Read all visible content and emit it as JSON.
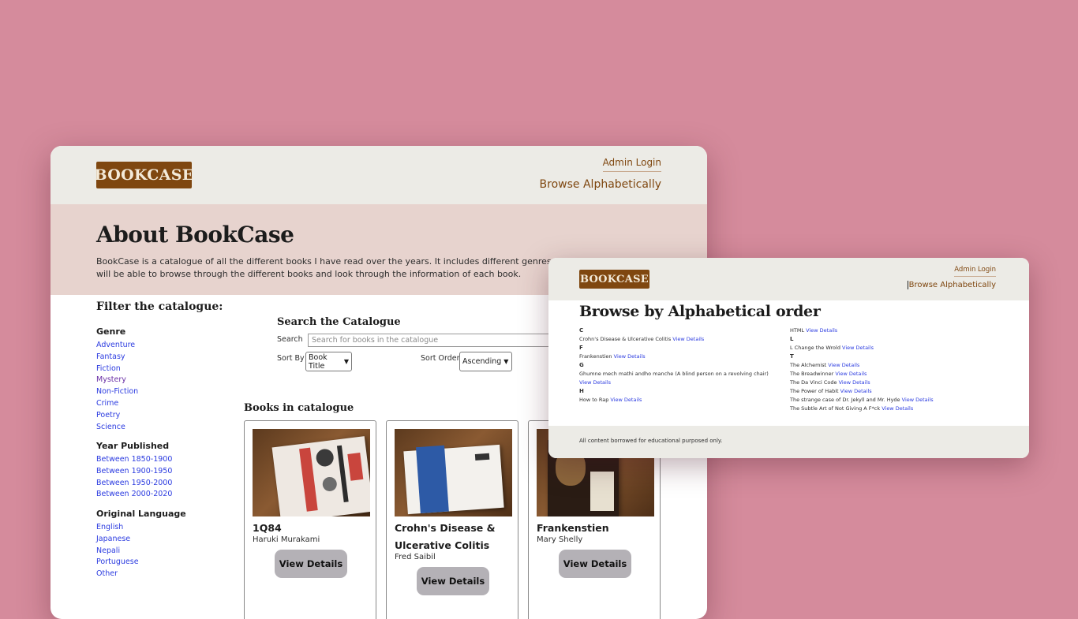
{
  "main_window": {
    "logo": "BOOKCASE",
    "nav": {
      "admin_login": "Admin Login",
      "browse": "Browse Alphabetically"
    },
    "about": {
      "title": "About BookCase",
      "description": "BookCase is a catalogue of all the different books I have read over the years. It includes different genres of books from fic... will be able to browse through the different books and look through the information of each book."
    },
    "filter": {
      "title": "Filter the catalogue:",
      "genre": {
        "heading": "Genre",
        "items": [
          "Adventure",
          "Fantasy",
          "Fiction",
          "Mystery",
          "Non-Fiction",
          "Crime",
          "Poetry",
          "Science"
        ]
      },
      "year": {
        "heading": "Year Published",
        "items": [
          "Between 1850-1900",
          "Between 1900-1950",
          "Between 1950-2000",
          "Between 2000-2020"
        ]
      },
      "language": {
        "heading": "Original Language",
        "items": [
          "English",
          "Japanese",
          "Nepali",
          "Portuguese",
          "Other"
        ]
      }
    },
    "search": {
      "title": "Search the Catalogue",
      "label": "Search",
      "placeholder": "Search for books in the catalogue",
      "sort_by_label": "Sort By",
      "sort_by_value": "Book Title",
      "sort_order_label": "Sort Order",
      "sort_order_value": "Ascending"
    },
    "books_title": "Books in catalogue",
    "books": [
      {
        "title": "1Q84",
        "author": "Haruki Murakami",
        "button": "View Details"
      },
      {
        "title": "Crohn's Disease & Ulcerative Colitis",
        "author": "Fred Saibil",
        "button": "View Details"
      },
      {
        "title": "Frankenstien",
        "author": "Mary Shelly",
        "button": "View Details"
      }
    ]
  },
  "browse_window": {
    "logo": "BOOKCASE",
    "nav": {
      "admin_login": "Admin Login",
      "browse": "Browse Alphabetically"
    },
    "title": "Browse by Alphabetical order",
    "view_label": "View Details",
    "left_column": [
      {
        "letter": "C",
        "entries": [
          "Crohn's Disease & Ulcerative Colitis"
        ]
      },
      {
        "letter": "F",
        "entries": [
          "Frankenstien"
        ]
      },
      {
        "letter": "G",
        "entries": [
          "Ghumne mech mathi andho manche (A blind person on a revolving chair)"
        ]
      },
      {
        "letter": "H",
        "entries": [
          "How to Rap"
        ]
      }
    ],
    "right_column_top": [
      "HTML"
    ],
    "right_column": [
      {
        "letter": "L",
        "entries": [
          "L Change the Wrold"
        ]
      },
      {
        "letter": "T",
        "entries": [
          "The Alchemist",
          "The Breadwinner",
          "The Da Vinci Code",
          "The Power of Habit",
          "The strange case of Dr. Jekyll and Mr. Hyde",
          "The Subtle Art of Not Giving A F*ck"
        ]
      }
    ],
    "footer": "All content borrowed for educational purposed only."
  },
  "colors": {
    "background": "#d58b9c",
    "brand": "#7f4710",
    "header": "#ecebe6",
    "about": "#e7d3ce",
    "link": "#2b3be0"
  }
}
